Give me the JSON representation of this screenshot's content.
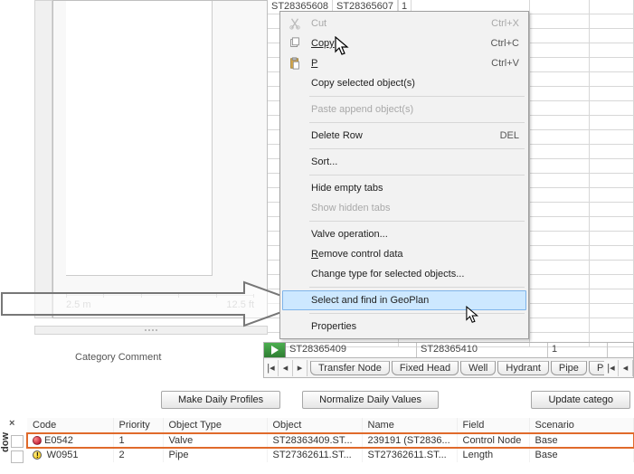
{
  "partial_row": {
    "c1": "ST28365608",
    "c2": "ST28365607",
    "c3": "1"
  },
  "strip_row": {
    "c1": "ST28365409",
    "c2": "ST28365410",
    "c3": "1"
  },
  "ruler": {
    "left": "2.5 m",
    "right": "12.5 ft"
  },
  "category_label": "Category Comment",
  "context_menu": {
    "cut": {
      "label": "Cut",
      "shortcut": "Ctrl+X"
    },
    "copy": {
      "label": "Copy",
      "shortcut": "Ctrl+C"
    },
    "paste": {
      "label": "Paste",
      "shortcut": "Ctrl+V",
      "visible_label": "P"
    },
    "copy_selected": {
      "label": "Copy selected object(s)"
    },
    "paste_append": {
      "label": "Paste append object(s)"
    },
    "delete_row": {
      "label": "Delete Row",
      "shortcut": "DEL"
    },
    "sort": {
      "label": "Sort..."
    },
    "hide_empty": {
      "label": "Hide empty tabs"
    },
    "show_hidden": {
      "label": "Show hidden tabs"
    },
    "valve_op": {
      "label": "Valve operation..."
    },
    "remove_ctrl": {
      "label_pre": "",
      "label_u": "R",
      "label_post": "emove control data"
    },
    "change_type": {
      "label": "Change type for selected objects..."
    },
    "select_find": {
      "label": "Select and find in GeoPlan"
    },
    "properties": {
      "label": "Properties"
    }
  },
  "tabs": [
    "Transfer Node",
    "Fixed Head",
    "Well",
    "Hydrant",
    "Pipe",
    "Pump Station"
  ],
  "buttons": {
    "make": "Make Daily Profiles",
    "normalize": "Normalize Daily Values",
    "update": "Update catego"
  },
  "table": {
    "headers": [
      "Code",
      "Priority",
      "Object Type",
      "Object",
      "Name",
      "Field",
      "Scenario"
    ],
    "rows": [
      {
        "code": "E0542",
        "priority": "1",
        "otype": "Valve",
        "object": "ST28363409.ST...",
        "name": "239191 (ST2836...",
        "field": "Control Node",
        "scenario": "Base",
        "icon": "red"
      },
      {
        "code": "W0951",
        "priority": "2",
        "otype": "Pipe",
        "object": "ST27362611.ST...",
        "name": "ST27362611.ST...",
        "field": "Length",
        "scenario": "Base",
        "icon": "yellow"
      }
    ]
  },
  "side_label": "dow",
  "close_x": "×"
}
